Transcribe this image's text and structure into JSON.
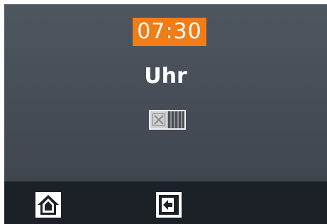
{
  "header": {
    "time": "07:30"
  },
  "main": {
    "title": "Uhr"
  },
  "toggle": {
    "state": "off"
  },
  "navigation": {
    "home_icon": "home-icon",
    "exit_icon": "exit-icon"
  },
  "colors": {
    "accent": "#f07d18",
    "screen_top": "#4e5660",
    "screen_bottom": "#3f464f",
    "bar": "#1c2128"
  }
}
